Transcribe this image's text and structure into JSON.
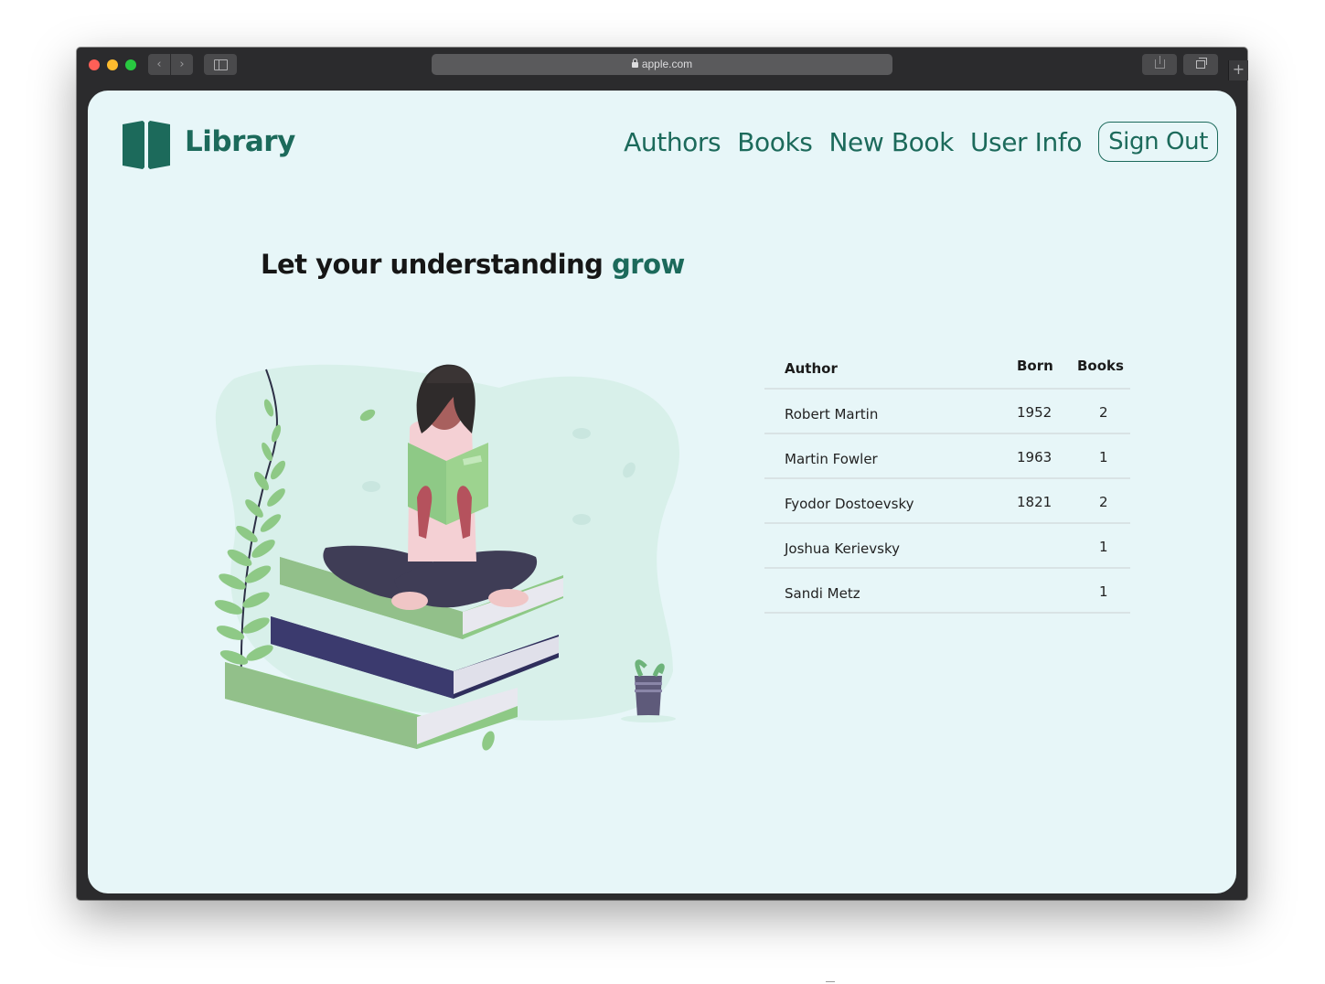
{
  "browser": {
    "url": "apple.com",
    "colors": {
      "close": "#fe5f57",
      "minimize": "#febc2e",
      "maximize": "#28c840"
    }
  },
  "site": {
    "brand": "Library",
    "nav": {
      "authors": "Authors",
      "books": "Books",
      "new_book": "New Book",
      "user_info": "User Info",
      "sign_out": "Sign Out"
    },
    "headline": {
      "lead": "Let your understanding ",
      "accent": "grow"
    },
    "colors": {
      "accent": "#1c6a5b",
      "background": "#e7f6f8"
    },
    "icons": {
      "logo": "open-book-icon"
    }
  },
  "authors_table": {
    "headers": {
      "author": "Author",
      "born": "Born",
      "books": "Books"
    },
    "rows": [
      {
        "author": "Robert Martin",
        "born": "1952",
        "books": "2"
      },
      {
        "author": "Martin Fowler",
        "born": "1963",
        "books": "1"
      },
      {
        "author": "Fyodor Dostoevsky",
        "born": "1821",
        "books": "2"
      },
      {
        "author": "Joshua Kerievsky",
        "born": "",
        "books": "1"
      },
      {
        "author": "Sandi Metz",
        "born": "",
        "books": "1"
      }
    ]
  }
}
